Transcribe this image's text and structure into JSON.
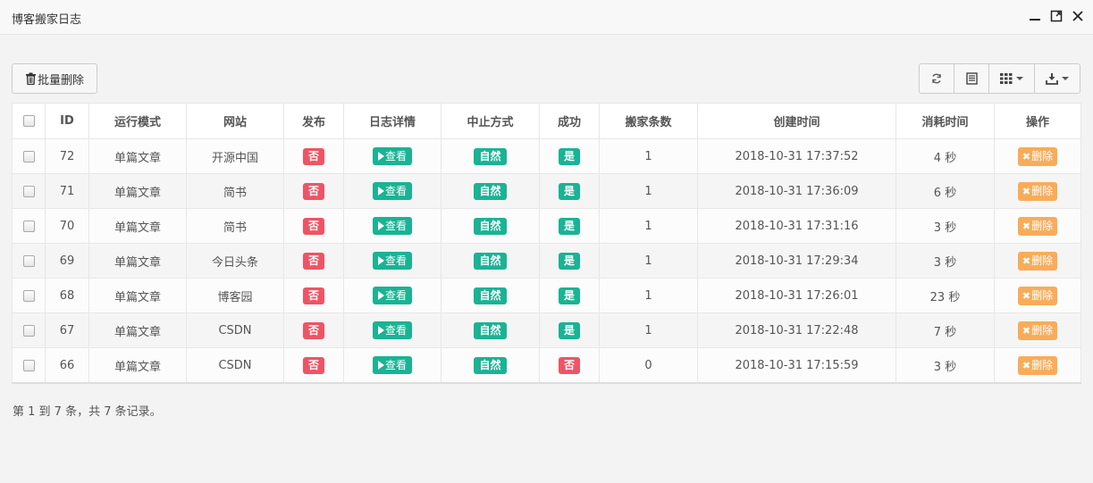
{
  "window": {
    "title": "博客搬家日志"
  },
  "toolbar": {
    "bulk_delete_label": "批量删除",
    "icons": [
      "refresh-icon",
      "toggle-view-icon",
      "columns-icon",
      "export-icon"
    ]
  },
  "table": {
    "headers": [
      "ID",
      "运行模式",
      "网站",
      "发布",
      "日志详情",
      "中止方式",
      "成功",
      "搬家条数",
      "创建时间",
      "消耗时间",
      "操作"
    ],
    "view_label": "查看",
    "delete_label": "删除",
    "rows": [
      {
        "id": "72",
        "mode": "单篇文章",
        "site": "开源中国",
        "publish": "否",
        "stop": "自然",
        "success": "是",
        "count": "1",
        "created": "2018-10-31 17:37:52",
        "elapsed": "4 秒"
      },
      {
        "id": "71",
        "mode": "单篇文章",
        "site": "简书",
        "publish": "否",
        "stop": "自然",
        "success": "是",
        "count": "1",
        "created": "2018-10-31 17:36:09",
        "elapsed": "6 秒"
      },
      {
        "id": "70",
        "mode": "单篇文章",
        "site": "简书",
        "publish": "否",
        "stop": "自然",
        "success": "是",
        "count": "1",
        "created": "2018-10-31 17:31:16",
        "elapsed": "3 秒"
      },
      {
        "id": "69",
        "mode": "单篇文章",
        "site": "今日头条",
        "publish": "否",
        "stop": "自然",
        "success": "是",
        "count": "1",
        "created": "2018-10-31 17:29:34",
        "elapsed": "3 秒"
      },
      {
        "id": "68",
        "mode": "单篇文章",
        "site": "博客园",
        "publish": "否",
        "stop": "自然",
        "success": "是",
        "count": "1",
        "created": "2018-10-31 17:26:01",
        "elapsed": "23 秒"
      },
      {
        "id": "67",
        "mode": "单篇文章",
        "site": "CSDN",
        "publish": "否",
        "stop": "自然",
        "success": "是",
        "count": "1",
        "created": "2018-10-31 17:22:48",
        "elapsed": "7 秒"
      },
      {
        "id": "66",
        "mode": "单篇文章",
        "site": "CSDN",
        "publish": "否",
        "stop": "自然",
        "success": "否",
        "count": "0",
        "created": "2018-10-31 17:15:59",
        "elapsed": "3 秒"
      }
    ]
  },
  "pagination": {
    "info": "第 1 到 7 条，共 7 条记录。"
  },
  "colors": {
    "danger": "#ed5565",
    "primary": "#1ab394",
    "warning": "#f8ac59"
  }
}
